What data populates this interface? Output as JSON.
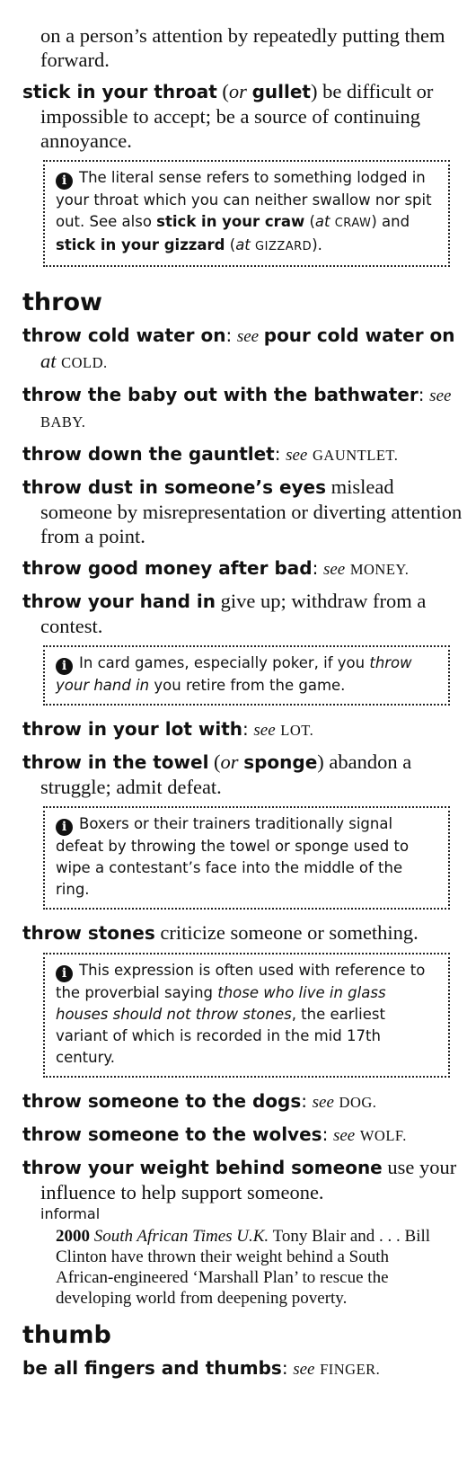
{
  "top_continuation": "on a person’s attention by repeatedly putting them forward.",
  "entry_stick_throat": {
    "head": "stick in your throat",
    "paren_open": " (",
    "or": "or",
    "alt": "gullet",
    "paren_close": ")",
    "definition": " be difficult or impossible to accept; be a source of continuing annoyance."
  },
  "note_stick": {
    "icon": "i",
    "text1": "The literal sense refers to something lodged in your throat which you can neither swallow nor spit out. See also ",
    "xref1": "stick in your craw",
    "text2": " (",
    "at1": "at",
    "sc1": "CRAW",
    "text3": ") and ",
    "xref2": "stick in your gizzard",
    "text4": " (",
    "at2": "at",
    "sc2": "GIZZARD",
    "text5": ")."
  },
  "section_throw": "throw",
  "entry_cold_water": {
    "head": "throw cold water on",
    "sep": ":",
    "see": "see",
    "xref": "pour cold water on",
    "at": "at",
    "sc": "COLD."
  },
  "entry_baby": {
    "head": "throw the baby out with the bathwater",
    "sep": ":",
    "see": "see",
    "sc": "BABY."
  },
  "entry_gauntlet": {
    "head": "throw down the gauntlet",
    "sep": ":",
    "see": "see",
    "sc": "GAUNTLET."
  },
  "entry_dust": {
    "head": "throw dust in someone’s eyes",
    "definition": " mislead someone by misrepresentation or diverting attention from a point."
  },
  "entry_money": {
    "head": "throw good money after bad",
    "sep": ":",
    "see": "see",
    "sc": "MONEY."
  },
  "entry_hand": {
    "head": "throw your hand in",
    "definition": " give up; withdraw from a contest."
  },
  "note_hand": {
    "icon": "i",
    "text1": "In card games, especially poker, if you ",
    "italic": "throw your hand in",
    "text2": " you retire from the game."
  },
  "entry_lot": {
    "head": "throw in your lot with",
    "sep": ":",
    "see": "see",
    "sc": "LOT."
  },
  "entry_towel": {
    "head": "throw in the towel",
    "paren_open": " (",
    "or": "or",
    "alt": "sponge",
    "paren_close": ")",
    "definition": " abandon a struggle; admit defeat."
  },
  "note_towel": {
    "icon": "i",
    "text": "Boxers or their trainers traditionally signal defeat by throwing the towel or sponge used to wipe a contestant’s face into the middle of the ring."
  },
  "entry_stones": {
    "head": "throw stones",
    "definition": " criticize someone or something."
  },
  "note_stones": {
    "icon": "i",
    "text1": "This expression is often used with reference to the proverbial saying ",
    "italic": "those who live in glass houses should not throw stones",
    "text2": ", the earliest variant of which is recorded in the mid 17th century."
  },
  "entry_dogs": {
    "head": "throw someone to the dogs",
    "sep": ":",
    "see": "see",
    "sc": "DOG."
  },
  "entry_wolves": {
    "head": "throw someone to the wolves",
    "sep": ":",
    "see": "see",
    "sc": "WOLF."
  },
  "entry_weight": {
    "head": "throw your weight behind someone",
    "definition": " use your influence to help support someone.",
    "register": "informal"
  },
  "quote_weight": {
    "year": "2000",
    "source": "South African Times U.K.",
    "text": " Tony Blair and . . . Bill Clinton have thrown their weight behind a South African-engineered ‘Marshall Plan’ to rescue the developing world from deepening poverty."
  },
  "section_thumb": "thumb",
  "entry_fingers": {
    "head": "be all fingers and thumbs",
    "sep": ":",
    "see": "see",
    "sc": "FINGER."
  }
}
